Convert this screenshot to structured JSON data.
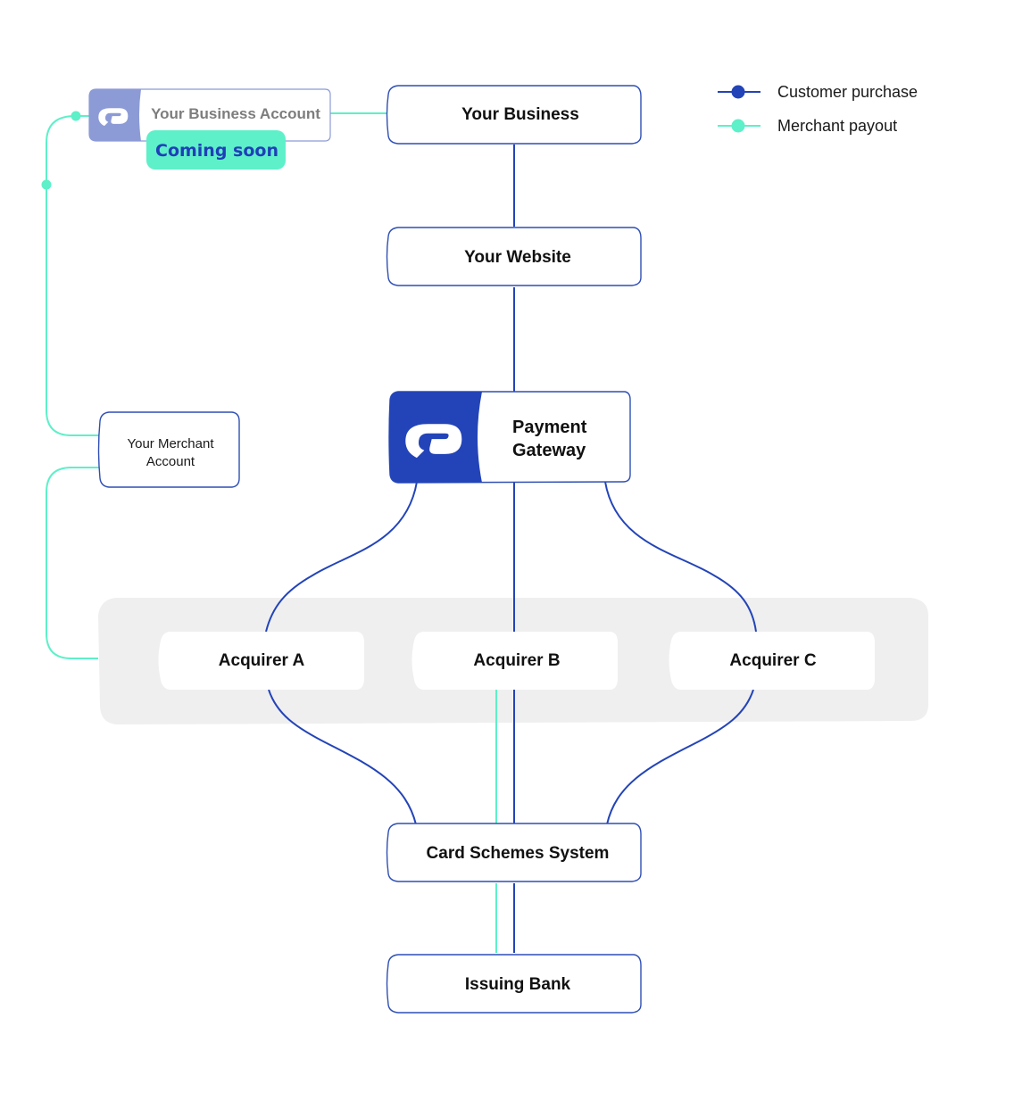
{
  "colors": {
    "customer_purchase": "#2344b8",
    "merchant_payout": "#5ef0c8",
    "brand_blue": "#2344b8",
    "brand_light": "#8c9bd6",
    "band_gray": "#efefef"
  },
  "legend": [
    {
      "label": "Customer purchase",
      "color_key": "customer_purchase",
      "icon": "line-dot-icon"
    },
    {
      "label": "Merchant payout",
      "color_key": "merchant_payout",
      "icon": "line-dot-icon"
    }
  ],
  "nodes": {
    "business_account": {
      "label": "Your Business Account",
      "badge": "Coming soon",
      "icon": "logo-icon"
    },
    "your_business": {
      "label": "Your Business"
    },
    "your_website": {
      "label": "Your Website"
    },
    "payment_gateway": {
      "label_line1": "Payment",
      "label_line2": "Gateway",
      "icon": "logo-icon"
    },
    "merchant_account": {
      "label_line1": "Your Merchant",
      "label_line2": "Account"
    },
    "acquirer_a": {
      "label": "Acquirer A"
    },
    "acquirer_b": {
      "label": "Acquirer B"
    },
    "acquirer_c": {
      "label": "Acquirer C"
    },
    "card_schemes": {
      "label": "Card Schemes System"
    },
    "issuing_bank": {
      "label": "Issuing Bank"
    }
  },
  "connections": [
    {
      "from": "your_business",
      "to": "your_website",
      "flow": "customer_purchase"
    },
    {
      "from": "your_website",
      "to": "payment_gateway",
      "flow": "customer_purchase"
    },
    {
      "from": "payment_gateway",
      "to": "acquirer_a",
      "flow": "customer_purchase"
    },
    {
      "from": "payment_gateway",
      "to": "acquirer_b",
      "flow": "customer_purchase"
    },
    {
      "from": "payment_gateway",
      "to": "acquirer_c",
      "flow": "customer_purchase"
    },
    {
      "from": "acquirer_a",
      "to": "card_schemes",
      "flow": "customer_purchase"
    },
    {
      "from": "acquirer_b",
      "to": "card_schemes",
      "flow": "customer_purchase"
    },
    {
      "from": "acquirer_c",
      "to": "card_schemes",
      "flow": "customer_purchase"
    },
    {
      "from": "card_schemes",
      "to": "issuing_bank",
      "flow": "customer_purchase"
    },
    {
      "from": "issuing_bank",
      "to": "card_schemes",
      "flow": "merchant_payout"
    },
    {
      "from": "card_schemes",
      "to": "acquirer_b",
      "flow": "merchant_payout"
    },
    {
      "from": "acquirers",
      "to": "merchant_account",
      "flow": "merchant_payout"
    },
    {
      "from": "merchant_account",
      "to": "business_account",
      "flow": "merchant_payout"
    },
    {
      "from": "business_account",
      "to": "your_business",
      "flow": "merchant_payout"
    }
  ]
}
